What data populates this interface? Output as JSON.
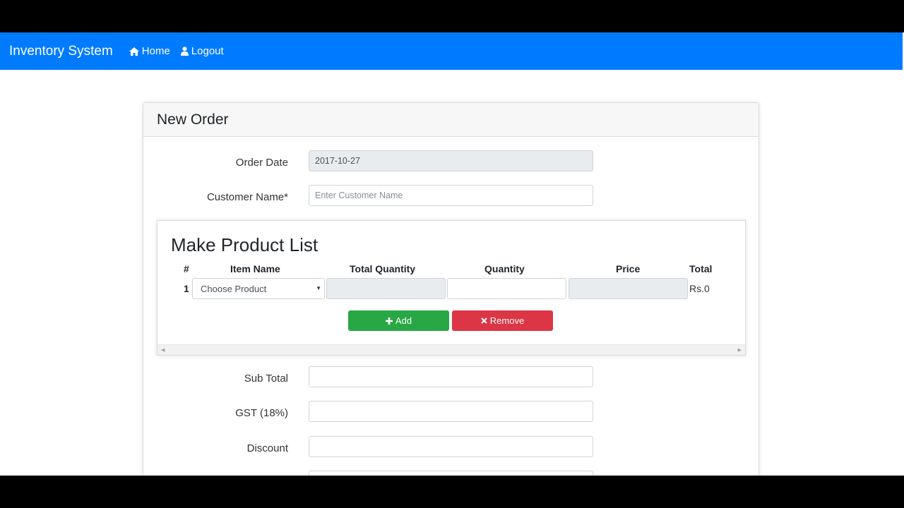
{
  "navbar": {
    "brand": "Inventory System",
    "links": [
      {
        "label": "Home",
        "icon": "home-icon"
      },
      {
        "label": "Logout",
        "icon": "user-icon"
      }
    ]
  },
  "card": {
    "title": "New Order"
  },
  "form": {
    "order_date_label": "Order Date",
    "order_date_value": "2017-10-27",
    "customer_name_label": "Customer Name*",
    "customer_name_placeholder": "Enter Customer Name",
    "sub_total_label": "Sub Total",
    "gst_label": "GST (18%)",
    "discount_label": "Discount"
  },
  "product_list": {
    "title": "Make Product List",
    "columns": [
      "#",
      "Item Name",
      "Total Quantity",
      "Quantity",
      "Price",
      "Total"
    ],
    "rows": [
      {
        "num": "1",
        "item_placeholder": "Choose Product",
        "total": "Rs.0"
      }
    ],
    "add_label": "Add",
    "remove_label": "Remove"
  },
  "colors": {
    "navbar": "#007bff",
    "add": "#28a745",
    "remove": "#dc3545"
  }
}
